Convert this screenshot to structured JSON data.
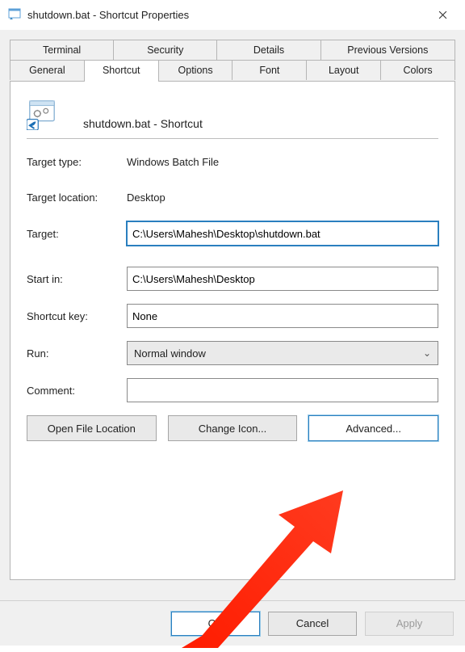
{
  "window": {
    "title": "shutdown.bat - Shortcut Properties"
  },
  "tabs": {
    "row1": [
      "Terminal",
      "Security",
      "Details",
      "Previous Versions"
    ],
    "row2": [
      "General",
      "Shortcut",
      "Options",
      "Font",
      "Layout",
      "Colors"
    ],
    "active": "Shortcut"
  },
  "header": {
    "name": "shutdown.bat - Shortcut"
  },
  "labels": {
    "target_type": "Target type:",
    "target_location": "Target location:",
    "target": "Target:",
    "start_in": "Start in:",
    "shortcut_key": "Shortcut key:",
    "run": "Run:",
    "comment": "Comment:"
  },
  "values": {
    "target_type": "Windows Batch File",
    "target_location": "Desktop",
    "target": "C:\\Users\\Mahesh\\Desktop\\shutdown.bat",
    "start_in": "C:\\Users\\Mahesh\\Desktop",
    "shortcut_key": "None",
    "run": "Normal window",
    "comment": ""
  },
  "buttons": {
    "open_file_location": "Open File Location",
    "change_icon": "Change Icon...",
    "advanced": "Advanced..."
  },
  "footer": {
    "ok": "OK",
    "cancel": "Cancel",
    "apply": "Apply"
  }
}
